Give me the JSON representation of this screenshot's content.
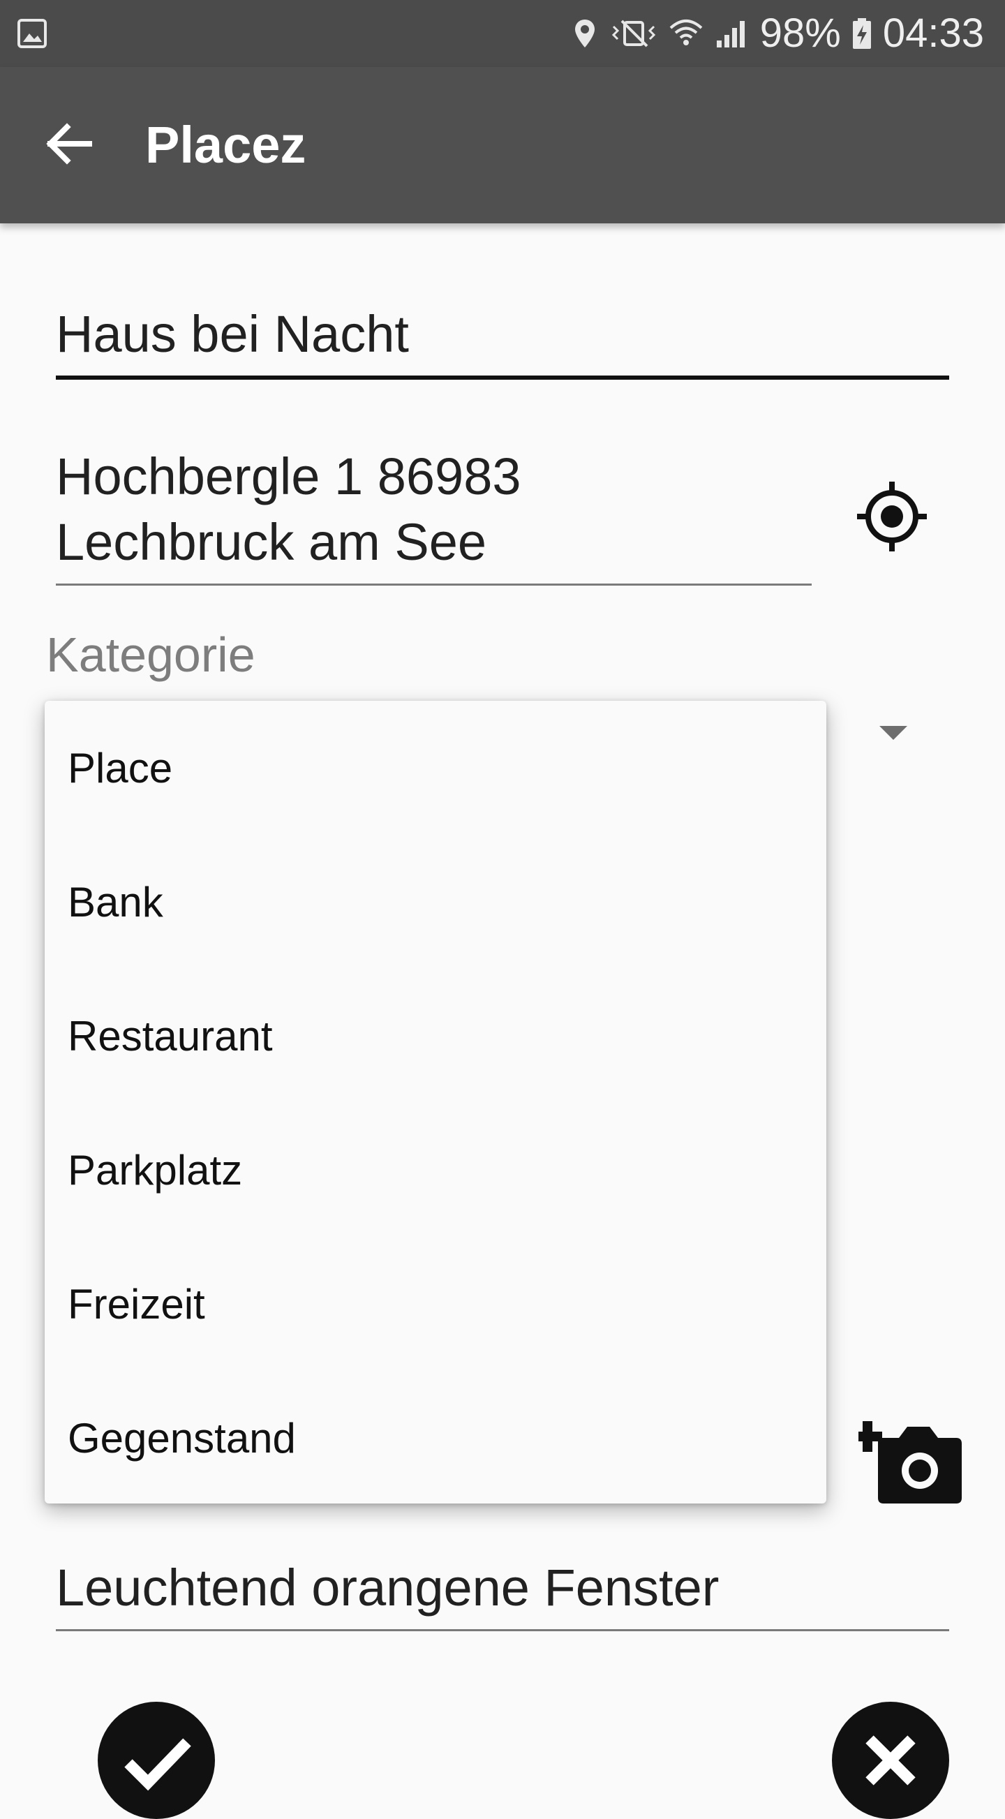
{
  "status_bar": {
    "battery": "98%",
    "time": "04:33",
    "icons": [
      "gallery-icon",
      "location-pin-icon",
      "vibrate-mute-icon",
      "wifi-icon",
      "signal-icon",
      "battery-charging-icon"
    ]
  },
  "app_bar": {
    "title": "Placez",
    "back_icon": "arrow-back-icon"
  },
  "form": {
    "name_value": "Haus bei Nacht",
    "address_line1": "Hochbergle 1 86983",
    "address_line2": "Lechbruck am See",
    "location_icon": "gps-fixed-icon",
    "category_label": "Kategorie",
    "camera_icon": "add-a-photo-icon",
    "description_value": "Leuchtend orangene Fenster",
    "confirm_icon": "check-icon",
    "cancel_icon": "close-icon"
  },
  "dropdown": {
    "items": [
      "Place",
      "Bank",
      "Restaurant",
      "Parkplatz",
      "Freizeit",
      "Gegenstand"
    ]
  },
  "colors": {
    "status_bar": "#4b4b4b",
    "app_bar": "#505050",
    "background": "#fafafa",
    "text": "#212121",
    "label": "#7d7d7d"
  }
}
